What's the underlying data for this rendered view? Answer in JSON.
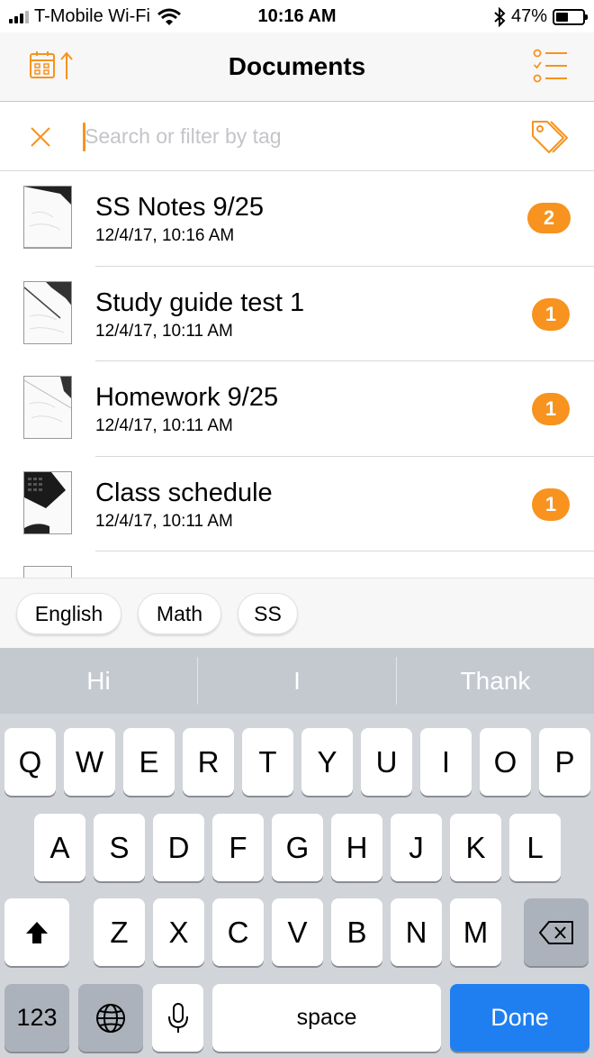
{
  "status_bar": {
    "carrier": "T-Mobile Wi-Fi",
    "time": "10:16 AM",
    "battery": "47%"
  },
  "nav": {
    "title": "Documents",
    "left_icon": "calendar-sort-icon",
    "right_icon": "checklist-icon"
  },
  "search": {
    "placeholder": "Search or filter by tag",
    "value": ""
  },
  "accent_color": "#f7931e",
  "documents": [
    {
      "title": "SS Notes 9/25",
      "date": "12/4/17, 10:16 AM",
      "count": "2"
    },
    {
      "title": "Study guide test 1",
      "date": "12/4/17, 10:11 AM",
      "count": "1"
    },
    {
      "title": "Homework 9/25",
      "date": "12/4/17, 10:11 AM",
      "count": "1"
    },
    {
      "title": "Class schedule",
      "date": "12/4/17, 10:11 AM",
      "count": "1"
    }
  ],
  "tags": [
    "English",
    "Math",
    "SS"
  ],
  "keyboard": {
    "predictions": [
      "Hi",
      "I",
      "Thank"
    ],
    "row1": [
      "Q",
      "W",
      "E",
      "R",
      "T",
      "Y",
      "U",
      "I",
      "O",
      "P"
    ],
    "row2": [
      "A",
      "S",
      "D",
      "F",
      "G",
      "H",
      "J",
      "K",
      "L"
    ],
    "row3": [
      "Z",
      "X",
      "C",
      "V",
      "B",
      "N",
      "M"
    ],
    "numbers_key": "123",
    "space_key": "space",
    "done_key": "Done"
  }
}
